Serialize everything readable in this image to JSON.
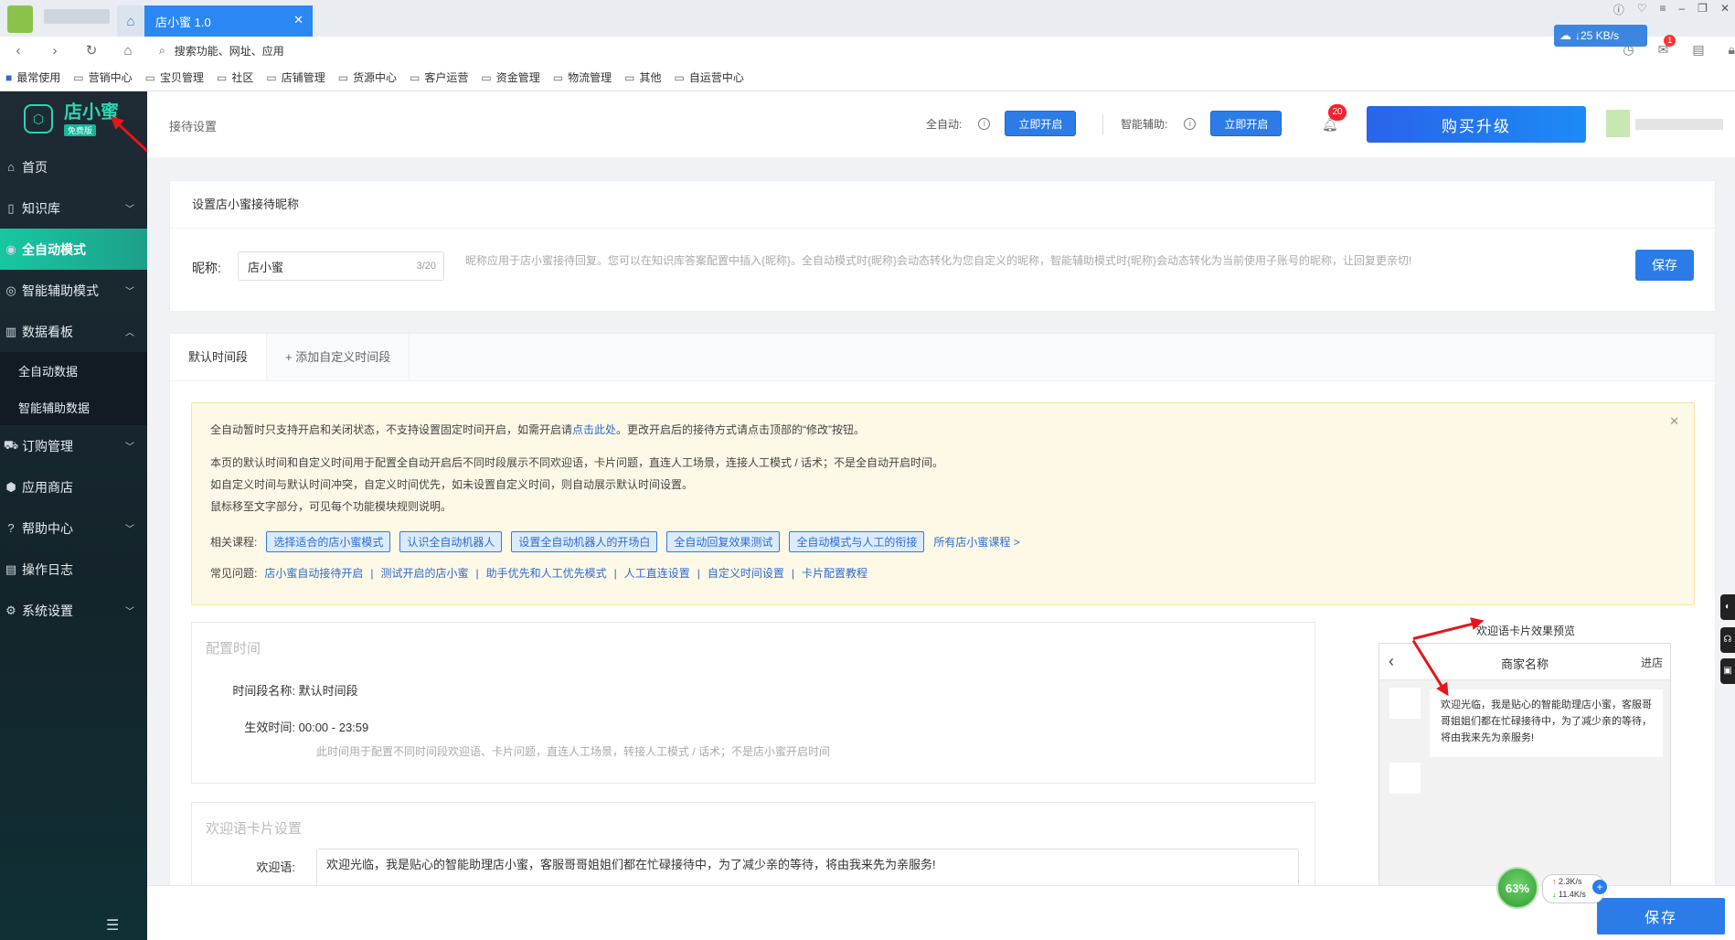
{
  "browser": {
    "tab_title": "店小蜜 1.0",
    "address_placeholder": "搜索功能、网址、应用",
    "net_speed": "↓25 KB/s",
    "mail_badge": "1",
    "bookmarks": [
      "最常使用",
      "营销中心",
      "宝贝管理",
      "社区",
      "店铺管理",
      "货源中心",
      "客户运营",
      "资金管理",
      "物流管理",
      "其他",
      "自运营中心"
    ]
  },
  "brand": {
    "name": "店小蜜",
    "badge": "免费版"
  },
  "sidebar": {
    "items": [
      {
        "label": "首页",
        "icon": "home-icon"
      },
      {
        "label": "知识库",
        "icon": "book-icon"
      },
      {
        "label": "全自动模式",
        "icon": "robot-icon"
      },
      {
        "label": "智能辅助模式",
        "icon": "assist-icon"
      },
      {
        "label": "数据看板",
        "icon": "chart-icon"
      },
      {
        "label": "订购管理",
        "icon": "cart-icon"
      },
      {
        "label": "应用商店",
        "icon": "box-icon"
      },
      {
        "label": "帮助中心",
        "icon": "help-icon"
      },
      {
        "label": "操作日志",
        "icon": "log-icon"
      },
      {
        "label": "系统设置",
        "icon": "gear-icon"
      }
    ],
    "sub_items": [
      "全自动数据",
      "智能辅助数据"
    ]
  },
  "header": {
    "crumb": "接待设置",
    "auto_label": "全自动:",
    "auto_btn": "立即开启",
    "assist_label": "智能辅助:",
    "assist_btn": "立即开启",
    "bell_badge": "20",
    "buy_btn": "购买升级"
  },
  "nickname": {
    "title": "设置店小蜜接待昵称",
    "label": "昵称:",
    "value": "店小蜜",
    "count": "3/20",
    "hint": "昵称应用于店小蜜接待回复。您可以在知识库答案配置中插入{昵称}。全自动模式时{昵称}会动态转化为您自定义的昵称，智能辅助模式时{昵称}会动态转化为当前使用子账号的昵称，让回复更亲切!",
    "save": "保存"
  },
  "tabs": [
    "默认时间段",
    "+ 添加自定义时间段"
  ],
  "notice": {
    "line1_a": "全自动暂时只支持开启和关闭状态，不支持设置固定时间开启，如需开启请",
    "line1_link": "点击此处",
    "line1_b": "。更改开启后的接待方式请点击顶部的“修改”按钮。",
    "line2": "本页的默认时间和自定义时间用于配置全自动开启后不同时段展示不同欢迎语，卡片问题，直连人工场景，连接人工模式 / 话术；不是全自动开启时间。",
    "line3": "如自定义时间与默认时间冲突，自定义时间优先，如未设置自定义时间，则自动展示默认时间设置。",
    "line4": "鼠标移至文字部分，可见每个功能模块规则说明。",
    "course_label": "相关课程:",
    "courses": [
      "选择适合的店小蜜模式",
      "认识全自动机器人",
      "设置全自动机器人的开场白",
      "全自动回复效果测试",
      "全自动模式与人工的衔接"
    ],
    "all_courses": "所有店小蜜课程 >",
    "faq_label": "常见问题:",
    "faqs": [
      "店小蜜自动接待开启",
      "测试开启的店小蜜",
      "助手优先和人工优先模式",
      "人工直连设置",
      "自定义时间设置",
      "卡片配置教程"
    ]
  },
  "config_time": {
    "title": "配置时间",
    "name_key": "时间段名称:",
    "name_val": "默认时间段",
    "time_key": "生效时间:",
    "time_val": "00:00 - 23:59",
    "hint": "此时间用于配置不同时间段欢迎语、卡片问题，直连人工场景，转接人工模式 / 话术；不是店小蜜开启时间"
  },
  "welcome": {
    "title": "欢迎语卡片设置",
    "key": "欢迎语:",
    "value": "欢迎光临，我是贴心的智能助理店小蜜，客服哥哥姐姐们都在忙碌接待中，为了减少亲的等待，将由我来先为亲服务!"
  },
  "preview": {
    "label": "欢迎语卡片效果预览",
    "shop_name": "商家名称",
    "enter": "进店",
    "bubble": "欢迎光临，我是贴心的智能助理店小蜜，客服哥哥姐姐们都在忙碌接待中，为了减少亲的等待，将由我来先为亲服务!"
  },
  "monitor": {
    "percent": "63%",
    "up": "2.3K/s",
    "down": "11.4K/s"
  },
  "bottom": {
    "save": "保存"
  },
  "colors": {
    "primary": "#2b7ce9",
    "sidebar_active": "#16c8a2",
    "brand": "#2ed3b3"
  }
}
